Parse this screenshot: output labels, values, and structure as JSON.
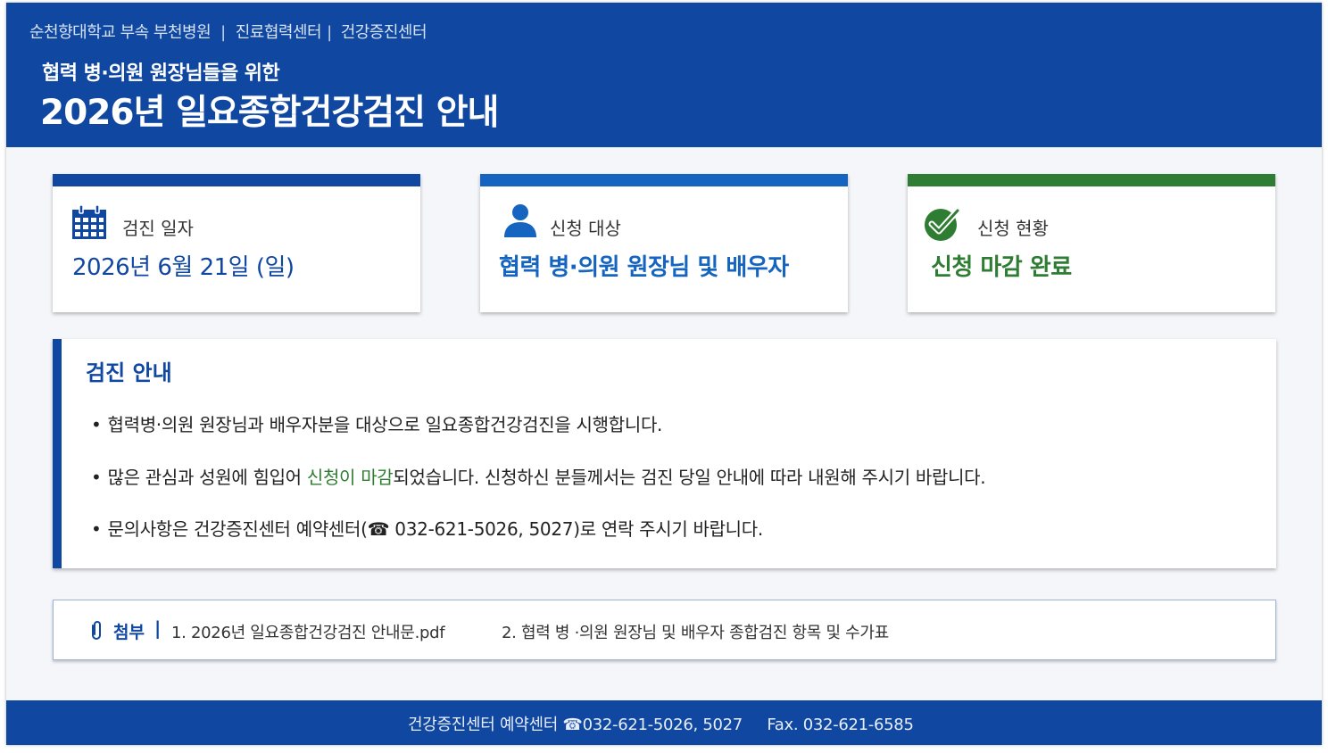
{
  "header": {
    "breadcrumb": [
      "순천향대학교 부속 부천병원",
      "진료협력센터",
      "건강증진센터"
    ],
    "breadcrumb_separator": "|",
    "subtitle": "협력 병·의원 원장님들을 위한",
    "title": "2026년 일요종합건강검진 안내"
  },
  "cards": [
    {
      "icon": "calendar-icon",
      "label": "검진 일자",
      "value": "2026년 6월 21일 (일)",
      "accent": "#0f47a1"
    },
    {
      "icon": "person-icon",
      "label": "신청 대상",
      "value": "협력 병·의원 원장님 및 배우자",
      "accent": "#1565c0"
    },
    {
      "icon": "check-circle-icon",
      "label": "신청 현황",
      "value": "신청 마감 완료",
      "accent": "#2e7d32"
    }
  ],
  "notice": {
    "heading": "검진 안내",
    "bullet": "•",
    "items": [
      {
        "text": "협력병·의원 원장님과 배우자분을 대상으로 일요종합건강검진을 시행합니다."
      },
      {
        "before": "많은 관심과 성원에 힘입어 ",
        "highlight": "신청이 마감",
        "after": "되었습니다. 신청하신 분들께서는 검진 당일 안내에 따라 내원해 주시기 바랍니다."
      },
      {
        "before": "문의사항은 건강증진센터 예약센터(",
        "phone_icon": "☎",
        "after": " 032-621-5026, 5027)로 연락 주시기 바랍니다."
      }
    ]
  },
  "attachments": {
    "label": "첨부",
    "separator": "|",
    "files": [
      "1. 2026년 일요종합건강검진 안내문.pdf",
      "2. 협력 병 ·의원 원장님 및 배우자 종합검진 항목 및 수가표"
    ]
  },
  "footer": {
    "center": "건강증진센터 예약센터",
    "phone_icon": "☎",
    "phone": "032-621-5026, 5027",
    "fax": "Fax. 032-621-6585"
  },
  "colors": {
    "primary": "#0f47a1",
    "secondary": "#1565c0",
    "success": "#2e7d32",
    "background": "#f4f6fa"
  }
}
